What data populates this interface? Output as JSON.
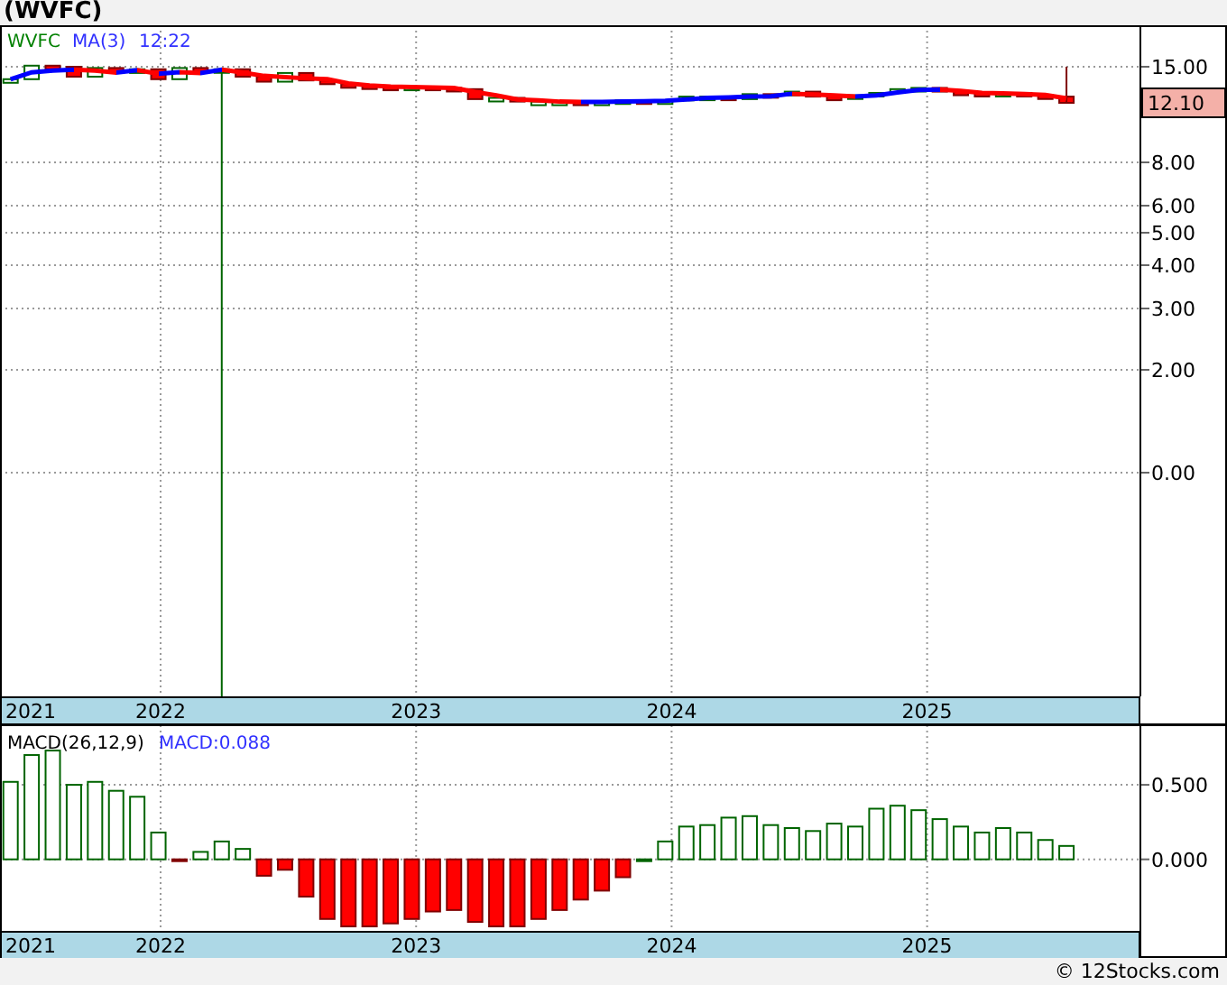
{
  "title": "(WVFC)",
  "price_panel": {
    "legend": {
      "symbol": "WVFC",
      "indicator": "MA(3)",
      "value": "12:22"
    },
    "last_price": "12.10",
    "y_axis_labels": [
      "15.00",
      "8.00",
      "6.00",
      "5.00",
      "4.00",
      "3.00",
      "2.00",
      "0.00"
    ],
    "year_labels": [
      "2021",
      "2022",
      "2023",
      "2024",
      "2025"
    ]
  },
  "macd_panel": {
    "legend_value": "MACD:0.088",
    "year_labels": [
      "2021",
      "2022",
      "2023",
      "2024",
      "2025"
    ],
    "chart_data": {
      "type": "bar",
      "ylim": [
        -0.48,
        0.9
      ],
      "grid": true,
      "series": [
        {
          "name": "MACD(26,12,9)",
          "values": [
            0.52,
            0.7,
            0.73,
            0.5,
            0.52,
            0.46,
            0.42,
            0.18,
            -0.01,
            0.05,
            0.12,
            0.07,
            -0.11,
            -0.07,
            -0.25,
            -0.4,
            -0.45,
            -0.45,
            -0.43,
            -0.4,
            -0.35,
            -0.34,
            -0.42,
            -0.45,
            -0.45,
            -0.4,
            -0.34,
            -0.27,
            -0.21,
            -0.12,
            0.0,
            0.12,
            0.22,
            0.23,
            0.28,
            0.29,
            0.23,
            0.21,
            0.19,
            0.24,
            0.22,
            0.34,
            0.36,
            0.33,
            0.27,
            0.22,
            0.18,
            0.21,
            0.18,
            0.13,
            0.09,
            null,
            null,
            null
          ]
        }
      ],
      "yticks": [
        {
          "value": 0.5,
          "label": "0.500"
        },
        {
          "value": 0,
          "label": "0.000"
        }
      ]
    }
  },
  "footer": "© 12Stocks.com"
}
